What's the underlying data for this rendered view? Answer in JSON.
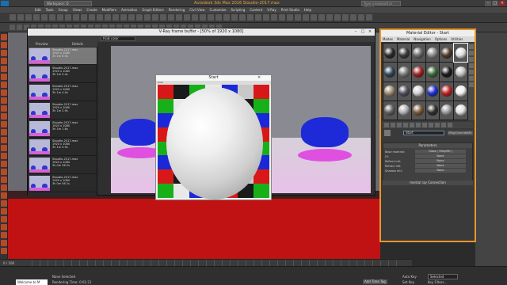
{
  "titlebar": {
    "workspace": "Workspace: D",
    "title": "Autodesk 3ds Max 2016      Staudio-2017.max",
    "search_placeholder": "Type a keyword or phrase"
  },
  "menu": [
    "Edit",
    "Tools",
    "Group",
    "Views",
    "Create",
    "Modifiers",
    "Animation",
    "Graph Editors",
    "Rendering",
    "Civil View",
    "Customize",
    "Scripting",
    "Content",
    "V-Ray",
    "Print Studio",
    "Help"
  ],
  "vfb": {
    "title": "V-Ray frame buffer - [50% of 1920 x 1080]",
    "channel_select": "RGB color",
    "history_headers": [
      "Preview",
      "Details"
    ],
    "history": [
      {
        "file": "Staudio-2017.max",
        "res": "1920 x 1080",
        "time": "3h 1m 6.9s"
      },
      {
        "file": "Staudio-2017.max",
        "res": "1920 x 1080",
        "time": "3h 1m 5.4s"
      },
      {
        "file": "Staudio-2017.max",
        "res": "1920 x 1080",
        "time": "3h 1m 4.0s"
      },
      {
        "file": "Staudio-2017.max",
        "res": "1920 x 1080",
        "time": "3h 1m 2.9s"
      },
      {
        "file": "Staudio-2017.max",
        "res": "1920 x 1080",
        "time": "3h 1m 1.6s"
      },
      {
        "file": "Staudio-2017.max",
        "res": "1920 x 1080",
        "time": "3h 1m 0.9s"
      },
      {
        "file": "Staudio-2017.max",
        "res": "1920 x 1080",
        "time": "3h 0m 58.2s"
      },
      {
        "file": "Staudio-2017.max",
        "res": "1920 x 1080",
        "time": "3h 0m 56.1s"
      }
    ]
  },
  "start_window": {
    "title": "Start",
    "auto_label": "Auto"
  },
  "material_editor": {
    "title": "Material Editor - Start",
    "menu": [
      "Modes",
      "Material",
      "Navigation",
      "Options",
      "Utilities"
    ],
    "material_name": "Start",
    "material_type": "VRayOverrideMtl",
    "params_header": "Parameters",
    "params": [
      {
        "label": "Base material:",
        "value": "Glass ( VRayMtl )"
      },
      {
        "label": "GI:",
        "value": "None"
      },
      {
        "label": "Reflect mtl:",
        "value": "None"
      },
      {
        "label": "Refract mtl:",
        "value": "None"
      },
      {
        "label": "Shadow mtl:",
        "value": "None"
      }
    ],
    "rollout2": "mental ray Connection",
    "slot_colors": [
      "#2a2a2a",
      "#3a3a3a",
      "#6b6b6b",
      "#8a8a8a",
      "#4f3a2a",
      "#dcdcdc",
      "#30455a",
      "#7a7a7a",
      "#a02020",
      "#3b6a3a",
      "#1a1a1a",
      "#c0c0c0",
      "#9a8a70",
      "#505060",
      "#d0d0d0",
      "#1f2fd0",
      "#c02020",
      "#f0f0f0",
      "#606060",
      "#b0b0b0",
      "#7a5a3a",
      "#303030",
      "#9a9a9a",
      "#e0e0e0"
    ]
  },
  "status": {
    "maxscript": "Welcome to M",
    "none_selected": "None Selected",
    "rendering_time": "Rendering Time: 0:01:21",
    "autokey": "Auto Key",
    "selected": "Selected",
    "set_key": "Set Key",
    "key_filters": "Key Filters...",
    "add_time_tag": "Add Time Tag",
    "frame": "0 / 100"
  },
  "checker_colors": [
    [
      "#d81818",
      "#1a1a1a",
      "#18b018",
      "#e8e8e8",
      "#1a28d8",
      "#c8c8c8",
      "#d81818"
    ],
    [
      "#18b018",
      "#e8e8e8",
      "#1a28d8",
      "#c8c8c8",
      "#d81818",
      "#1a1a1a",
      "#18b018"
    ],
    [
      "#1a28d8",
      "#c8c8c8",
      "#d81818",
      "#1a1a1a",
      "#18b018",
      "#e8e8e8",
      "#1a28d8"
    ],
    [
      "#d81818",
      "#1a1a1a",
      "#18b018",
      "#e8e8e8",
      "#1a28d8",
      "#c8c8c8",
      "#d81818"
    ],
    [
      "#18b018",
      "#e8e8e8",
      "#1a28d8",
      "#c8c8c8",
      "#d81818",
      "#1a1a1a",
      "#18b018"
    ],
    [
      "#1a28d8",
      "#c8c8c8",
      "#d81818",
      "#1a1a1a",
      "#18b018",
      "#e8e8e8",
      "#1a28d8"
    ],
    [
      "#d81818",
      "#1a1a1a",
      "#18b018",
      "#e8e8e8",
      "#1a28d8",
      "#c8c8c8",
      "#d81818"
    ],
    [
      "#18b018",
      "#e8e8e8",
      "#1a28d8",
      "#c8c8c8",
      "#d81818",
      "#1a1a1a",
      "#18b018"
    ]
  ],
  "colors": {
    "accent_orange": "#e8962a",
    "teapot_blue": "#1e2ad8",
    "floor_red": "#c01212"
  }
}
